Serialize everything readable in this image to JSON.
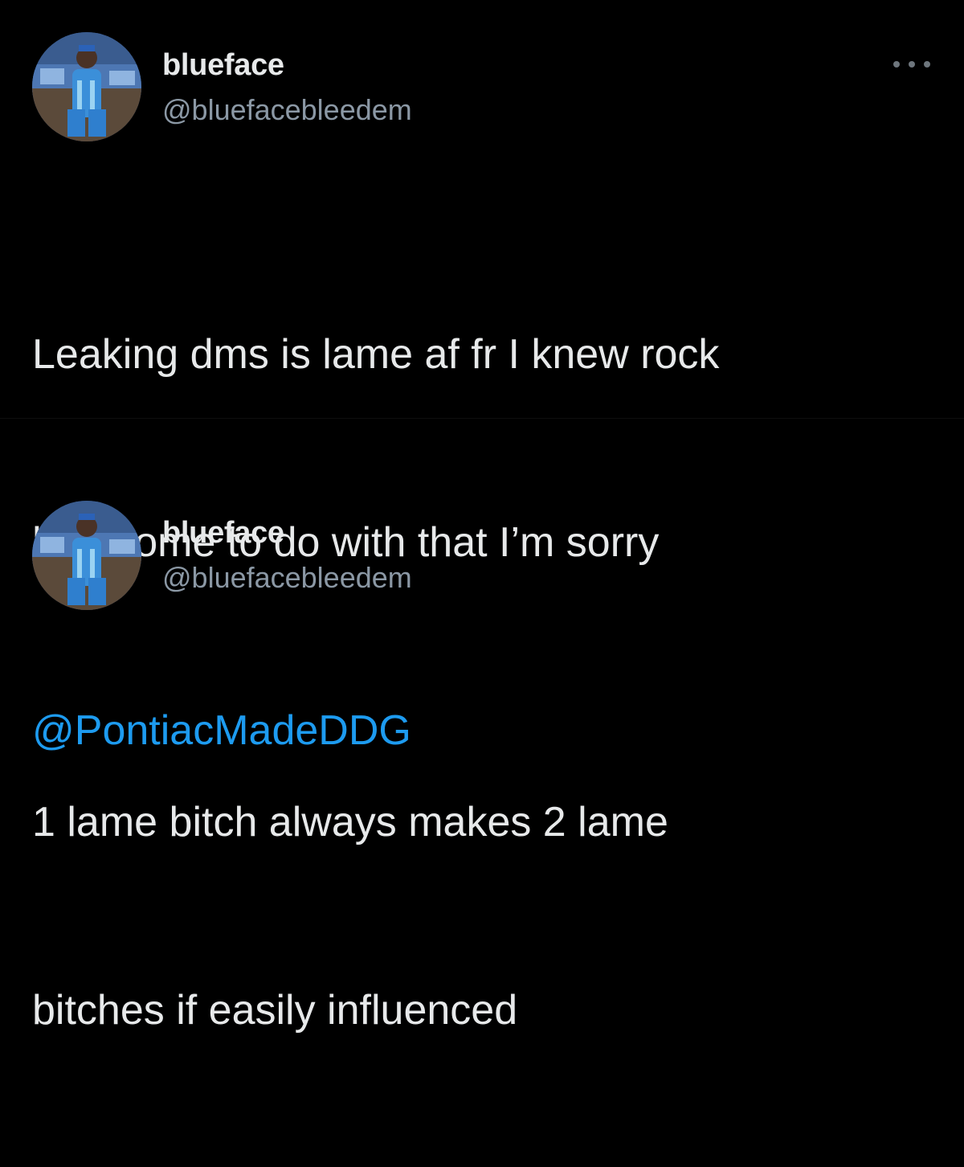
{
  "tweets": [
    {
      "display_name": "blueface",
      "handle": "@bluefacebleedem",
      "avatar_icon": "profile-avatar",
      "more_icon": "more-options-icon",
      "text_lines": [
        "Leaking dms is lame af fr I knew rock",
        "had some to do with that I’m sorry"
      ],
      "mention": "@PontiacMadeDDG"
    },
    {
      "display_name": "blueface",
      "handle": "@bluefacebleedem",
      "avatar_icon": "profile-avatar",
      "text_lines": [
        "1 lame bitch always makes 2 lame",
        "bitches if easily influenced"
      ]
    }
  ],
  "colors": {
    "background": "#000000",
    "text": "#e7e9ea",
    "secondary_text": "#8b98a5",
    "mention": "#1d9bf0"
  }
}
